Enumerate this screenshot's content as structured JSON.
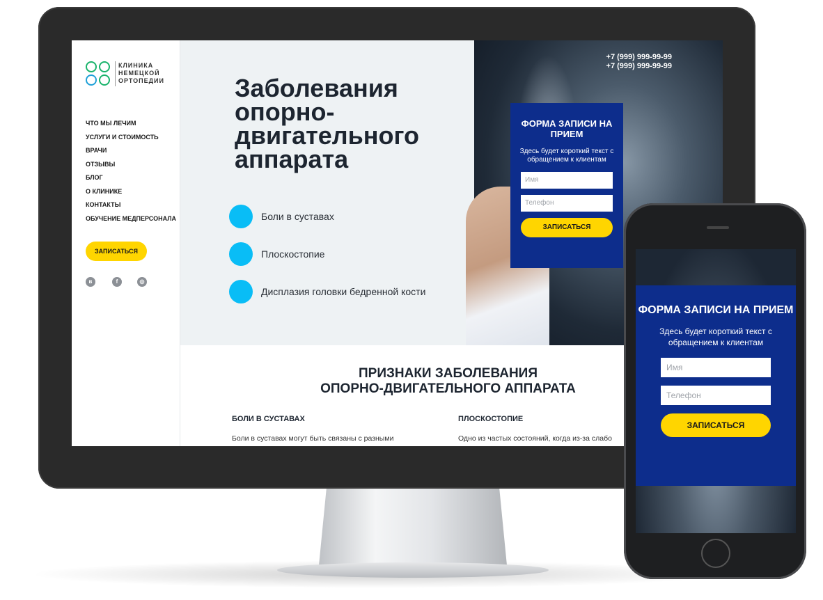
{
  "logo": {
    "lines": [
      "КЛИНИКА",
      "НЕМЕЦКОЙ",
      "ОРТОПЕДИИ"
    ]
  },
  "menu": [
    "ЧТО МЫ ЛЕЧИМ",
    "УСЛУГИ И СТОИМОСТЬ",
    "ВРАЧИ",
    "ОТЗЫВЫ",
    "БЛОГ",
    "О КЛИНИКЕ",
    "КОНТАКТЫ",
    "ОБУЧЕНИЕ МЕДПЕРСОНАЛА"
  ],
  "sidebar_cta": "ЗАПИСАТЬСЯ",
  "socials": [
    "vk-icon",
    "facebook-icon",
    "instagram-icon"
  ],
  "colors": {
    "accent_yellow": "#ffd500",
    "form_blue": "#0d2d8c",
    "dot_cyan": "#09bdf6"
  },
  "hero": {
    "title": "Заболевания опорно-двигательного аппарата",
    "phones": [
      "+7 (999) 999-99-99",
      "+7 (999) 999-99-99"
    ],
    "items": [
      "Боли в суставах",
      "Плоскостопие",
      "Дисплазия головки бедренной кости"
    ]
  },
  "form": {
    "title": "ФОРМА ЗАПИСИ НА ПРИЕМ",
    "subtitle": "Здесь будет короткий текст с обращением к клиентам",
    "name_placeholder": "Имя",
    "phone_placeholder": "Телефон",
    "submit": "ЗАПИСАТЬСЯ"
  },
  "section": {
    "title_line1": "ПРИЗНАКИ ЗАБОЛЕВАНИЯ",
    "title_line2": "ОПОРНО-ДВИГАТЕЛЬНОГО АППАРАТА",
    "col1_heading": "БОЛИ В СУСТАВАХ",
    "col1_text": "Боли в суставах могут быть связаны с разными",
    "col2_heading": "ПЛОСКОСТОПИЕ",
    "col2_text": "Одно из частых состояний, когда из-за слабо"
  }
}
